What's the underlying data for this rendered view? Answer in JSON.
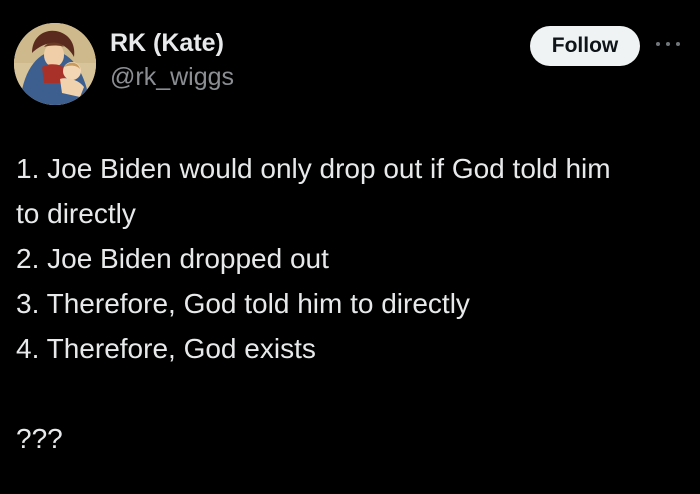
{
  "author": {
    "display_name": "RK (Kate)",
    "handle": "@rk_wiggs",
    "avatar_icon": "madonna-and-child-painting"
  },
  "actions": {
    "follow_label": "Follow",
    "more_icon": "more-horizontal-icon"
  },
  "tweet": {
    "lines": [
      "1. Joe Biden would only drop out if God told him",
      "to directly",
      "2. Joe Biden dropped out",
      "3. Therefore, God told him to directly",
      "4. Therefore, God exists"
    ],
    "closing": "???"
  },
  "colors": {
    "background": "#000000",
    "text_primary": "#e7e9ea",
    "text_secondary": "#8b8f94",
    "button_bg": "#eff3f4",
    "button_text": "#0f1419"
  }
}
